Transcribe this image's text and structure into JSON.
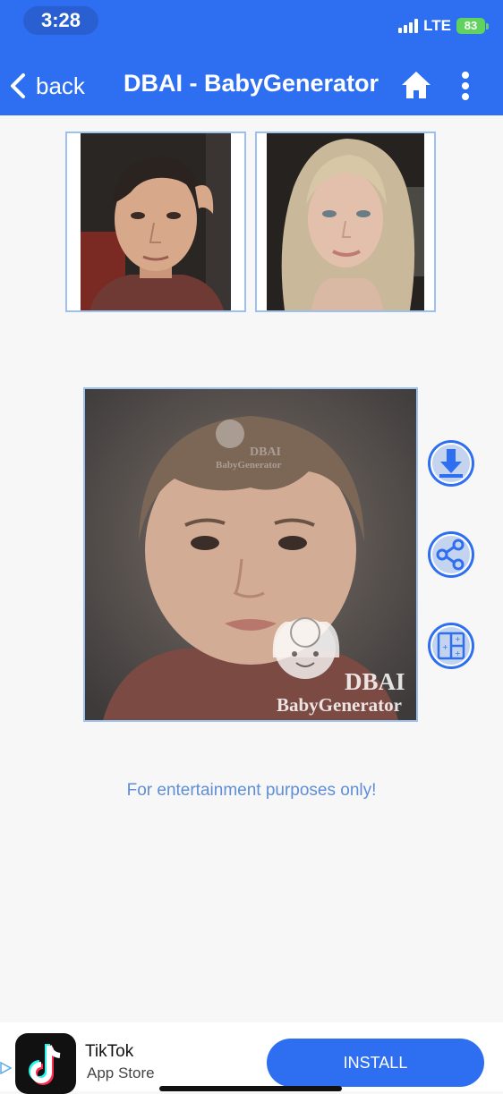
{
  "status_bar": {
    "time": "3:28",
    "network": "LTE",
    "battery": "83"
  },
  "header": {
    "back_label": "back",
    "title": "DBAI - BabyGenerator"
  },
  "watermark": {
    "brand": "DBAI",
    "product": "BabyGenerator"
  },
  "disclaimer": "For entertainment purposes only!",
  "ad": {
    "app_name": "TikTok",
    "store": "App Store",
    "cta": "INSTALL"
  },
  "colors": {
    "header": "#2e6ff2",
    "accent": "#2e6ff2",
    "disclaimer": "#5f8ed6"
  },
  "icons": {
    "back": "chevron-left",
    "home": "house",
    "more": "vertical-ellipsis",
    "download": "download-arrow",
    "share": "share-nodes",
    "compare": "grid-compare"
  }
}
